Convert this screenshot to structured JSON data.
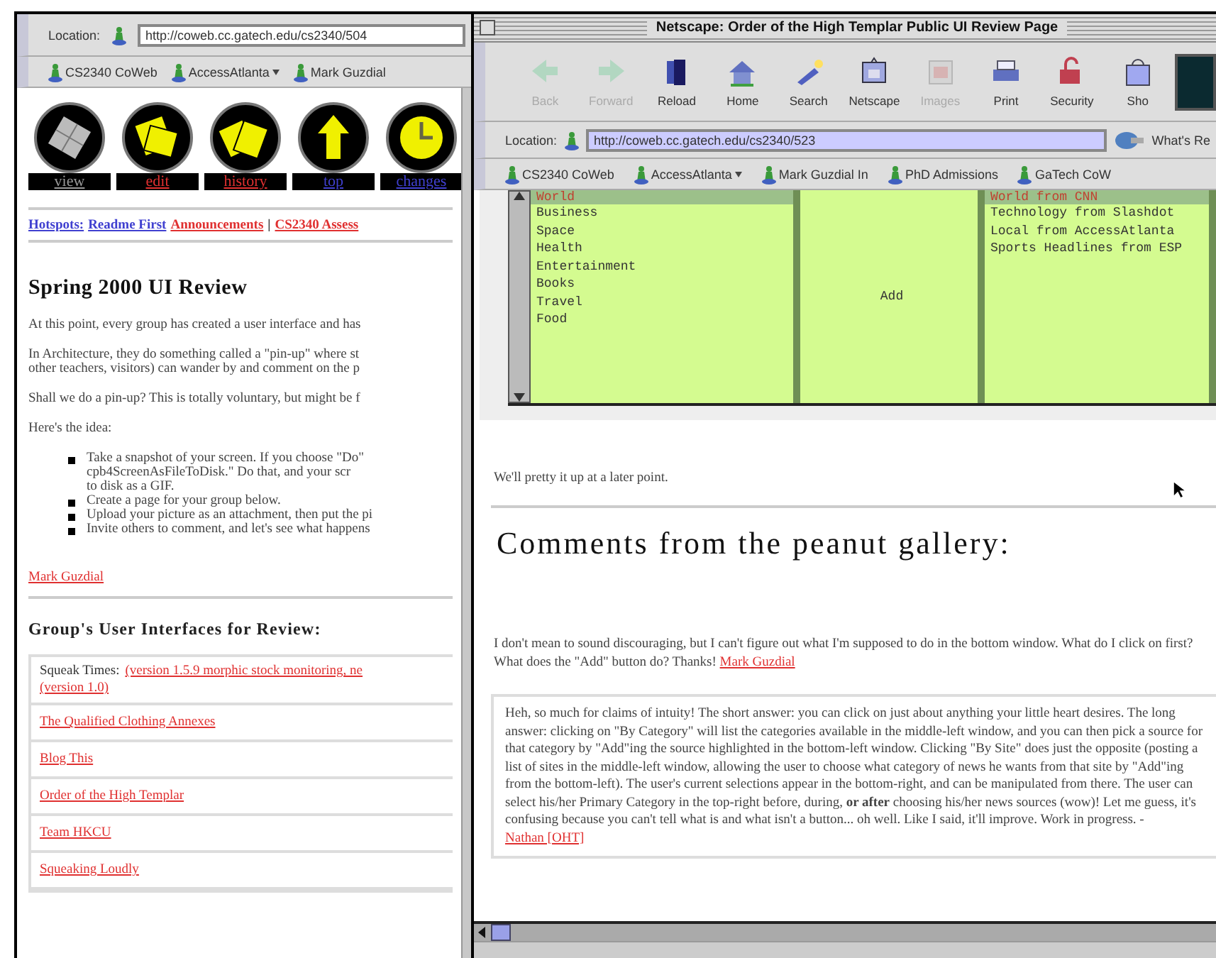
{
  "left_window": {
    "location": {
      "label": "Location:",
      "url": "http://coweb.cc.gatech.edu/cs2340/504"
    },
    "bookmarks": [
      {
        "label": "CS2340 CoWeb",
        "menu": false
      },
      {
        "label": "AccessAtlanta",
        "menu": true
      },
      {
        "label": "Mark Guzdial"
      }
    ],
    "page_buttons": [
      {
        "label": "view",
        "kind": "current"
      },
      {
        "label": "edit",
        "kind": "visited"
      },
      {
        "label": "history",
        "kind": "visited"
      },
      {
        "label": "top",
        "kind": "link"
      },
      {
        "label": "changes",
        "kind": "link"
      }
    ],
    "hotspots": {
      "label": "Hotspots:",
      "separator": "|",
      "links": [
        {
          "text": "Readme First",
          "visited": false
        },
        {
          "text": "Announcements",
          "visited": true
        },
        {
          "text": "CS2340 Assess",
          "visited": true
        }
      ]
    },
    "heading": "Spring 2000 UI Review",
    "paragraphs": [
      {
        "lines": [
          "At this point, every group has created a user interface and has"
        ]
      },
      {
        "lines": [
          "In Architecture, they do something called a \"pin-up\" where st",
          "other teachers, visitors) can wander by and comment on the p"
        ]
      },
      {
        "lines": [
          "Shall we do a pin-up? This is totally voluntary, but might be f"
        ]
      },
      {
        "lines": [
          "Here's the idea:"
        ]
      }
    ],
    "bullets": [
      {
        "lines": [
          "Take a snapshot of your screen. If you choose \"Do\"",
          "cpb4ScreenAsFileToDisk.\" Do that, and your scr",
          "to disk as a GIF."
        ]
      },
      {
        "lines": [
          "Create a page for your group below."
        ]
      },
      {
        "lines": [
          "Upload your picture as an attachment, then put the pi"
        ]
      },
      {
        "lines": [
          "Invite others to comment, and let's see what happens"
        ]
      }
    ],
    "signature": "Mark Guzdial",
    "groups_heading": "Group's User Interfaces for Review:",
    "groups": [
      {
        "lines": [
          [
            {
              "text": "Squeak Times:",
              "link": false
            },
            {
              "text": "(version 1.5.9 morphic stock monitoring, ne",
              "link": true
            }
          ],
          [
            {
              "text": "(version 1.0)",
              "link": true
            }
          ]
        ]
      },
      {
        "lines": [
          [
            {
              "text": "The Qualified Clothing Annexes",
              "link": true
            }
          ]
        ]
      },
      {
        "lines": [
          [
            {
              "text": "Blog This",
              "link": true
            }
          ]
        ]
      },
      {
        "lines": [
          [
            {
              "text": "Order of the High Templar",
              "link": true
            }
          ]
        ]
      },
      {
        "lines": [
          [
            {
              "text": "Team HKCU",
              "link": true
            }
          ]
        ]
      },
      {
        "lines": [
          [
            {
              "text": "Squeaking Loudly",
              "link": true
            }
          ]
        ]
      }
    ]
  },
  "right_window": {
    "title": "Netscape: Order of the High Templar Public UI Review Page",
    "toolbar": [
      {
        "label": "Back",
        "disabled": true
      },
      {
        "label": "Forward",
        "disabled": true
      },
      {
        "label": "Reload",
        "disabled": false
      },
      {
        "label": "Home",
        "disabled": false
      },
      {
        "label": "Search",
        "disabled": false
      },
      {
        "label": "Netscape",
        "disabled": false
      },
      {
        "label": "Images",
        "disabled": true
      },
      {
        "label": "Print",
        "disabled": false
      },
      {
        "label": "Security",
        "disabled": false
      },
      {
        "label": "Sho",
        "disabled": false
      }
    ],
    "location": {
      "label": "Location:",
      "url": "http://coweb.cc.gatech.edu/cs2340/523",
      "selected": true
    },
    "related": "What's Re",
    "bookmarks": [
      {
        "label": "CS2340 CoWeb",
        "menu": false
      },
      {
        "label": "AccessAtlanta",
        "menu": true
      },
      {
        "label": "Mark Guzdial In",
        "menu": false
      },
      {
        "label": "PhD Admissions",
        "menu": false
      },
      {
        "label": "GaTech CoW",
        "menu": false
      }
    ],
    "frames": {
      "categories": {
        "header": "World",
        "items": [
          "Business",
          "Space",
          "Health",
          "Entertainment",
          "Books",
          "Travel",
          "Food"
        ]
      },
      "add_button": "Add",
      "sources": {
        "header": "World from CNN",
        "items": [
          "Technology from Slashdot",
          "Local from AccessAtlanta",
          "Sports Headlines from ESP"
        ]
      }
    },
    "note": "We'll pretty it up at a later point.",
    "comments_heading": "Comments from the peanut gallery:",
    "comments": [
      {
        "text": "I don't mean to sound discouraging, but I can't figure out what I'm supposed to do in the bottom window. What do I click on first? What does the \"Add\" button do? Thanks!",
        "author": "Mark Guzdial",
        "boxed": false
      },
      {
        "text": "Heh, so much for claims of intuity! The short answer: you can click on just about anything your little heart desires. The long answer: clicking on \"By Category\" will list the categories available in the middle-left window, and you can then pick a source for that category by \"Add\"ing the source highlighted in the bottom-left window. Clicking \"By Site\" does just the opposite (posting a list of sites in the middle-left window, allowing the user to choose what category of news he wants from that site by \"Add\"ing from the bottom-left). The user's current selections appear in the bottom-right, and can be manipulated from there. The user can select his/her Primary Category in the top-right before, during, **or after** choosing his/her news sources (wow)! Let me guess, it's confusing because you can't tell what is and what isn't a button... oh well. Like I said, it'll improve. Work in progress. -",
        "author": "Nathan [OHT]",
        "boxed": true
      }
    ]
  }
}
